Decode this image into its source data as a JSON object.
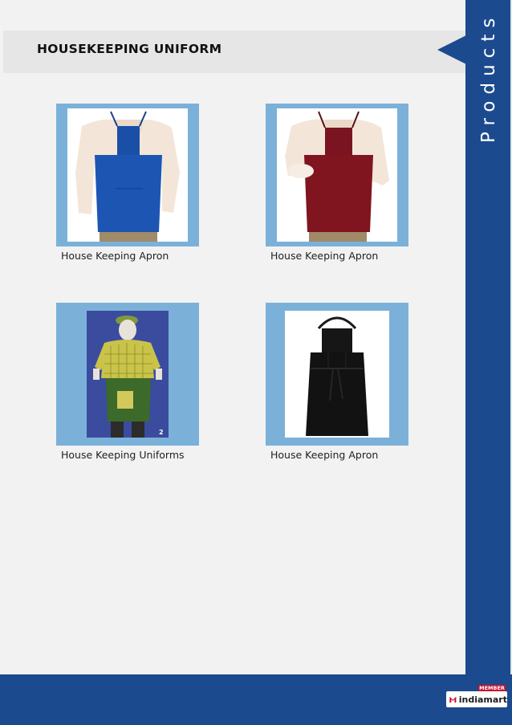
{
  "header": {
    "title": "HOUSEKEEPING UNIFORM"
  },
  "sidebar": {
    "label": "Products"
  },
  "products": [
    {
      "caption": "House Keeping Apron"
    },
    {
      "caption": "House Keeping Apron"
    },
    {
      "caption": "House Keeping Uniforms",
      "photo_number": "2"
    },
    {
      "caption": "House Keeping Apron"
    }
  ],
  "footer": {
    "logo_member": "MEMBER",
    "logo_brand": "indiamart"
  },
  "colors": {
    "brand_blue": "#1c4a8e",
    "frame_blue": "#7bb1d9",
    "logo_red": "#c8102e"
  }
}
